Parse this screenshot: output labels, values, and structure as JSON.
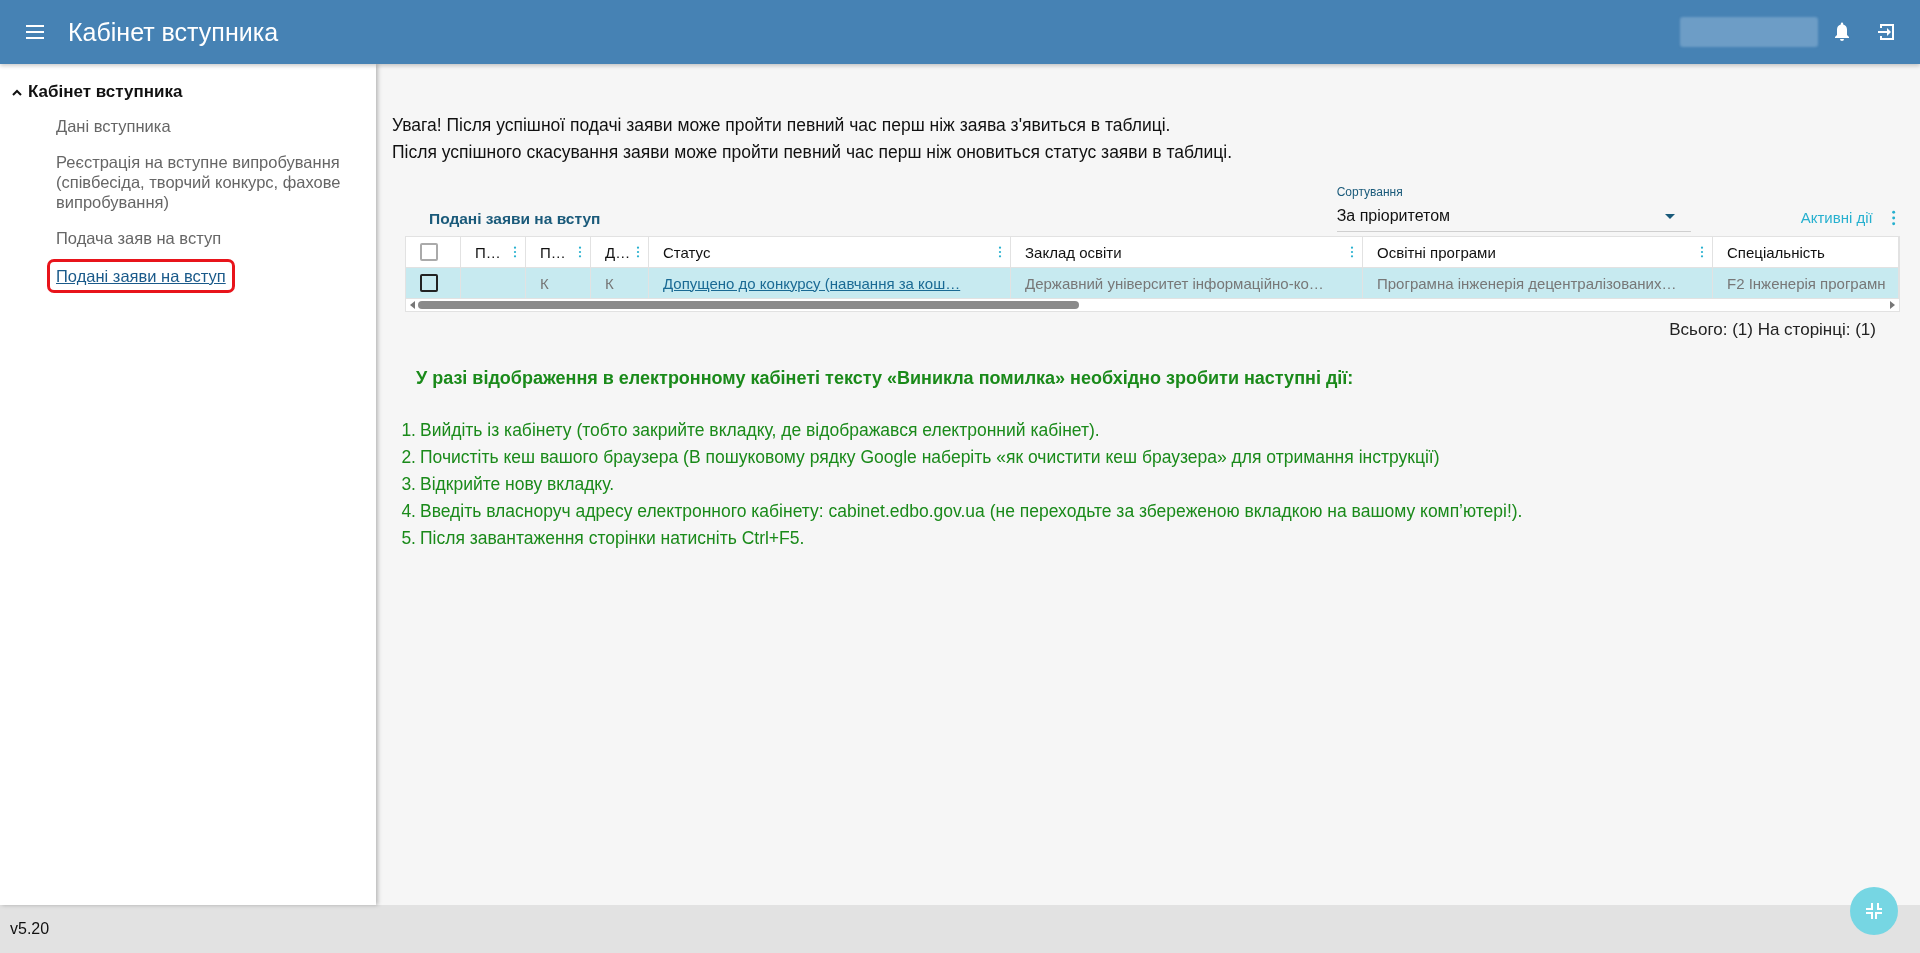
{
  "header": {
    "title": "Кабінет вступника"
  },
  "sidebar": {
    "section": {
      "label": "Кабінет вступника",
      "expanded": true
    },
    "items": [
      {
        "label": "Дані вступника",
        "selected": false
      },
      {
        "label": "Реєстрація на вступне випробування (співбесіда, творчий конкурс, фахове випробування)",
        "selected": false
      },
      {
        "label": "Подача заяв на вступ",
        "selected": false
      },
      {
        "label": "Подані заяви на вступ",
        "selected": true
      }
    ]
  },
  "notice": [
    "Увага! Після успішної подачі заяви може пройти певний час перш ніж заява з'явиться в таблиці.",
    "Після успішного скасування заяви може пройти певний час перш ніж оновиться статус заяви в таблиці."
  ],
  "table": {
    "title": "Подані заяви на вступ",
    "sort": {
      "label": "Сортування",
      "value": "За пріоритетом"
    },
    "actions_label": "Активні дії",
    "columns": [
      {
        "kind": "checkbox",
        "checked": false
      },
      {
        "kind": "text",
        "label": "П…",
        "menu": true
      },
      {
        "kind": "text",
        "label": "П…",
        "menu": true
      },
      {
        "kind": "text",
        "label": "Д…",
        "menu": true
      },
      {
        "kind": "text",
        "label": "Статус",
        "menu": true
      },
      {
        "kind": "text",
        "label": "Заклад освіти",
        "menu": true
      },
      {
        "kind": "text",
        "label": "Освітні програми",
        "menu": true
      },
      {
        "kind": "text",
        "label": "Спеціальність",
        "menu": false
      }
    ],
    "rows": [
      {
        "selected": true,
        "cells": [
          {
            "kind": "checkbox",
            "checked": false
          },
          {
            "kind": "empty"
          },
          {
            "kind": "text",
            "text": "К"
          },
          {
            "kind": "text",
            "text": "К"
          },
          {
            "kind": "link",
            "text": "Допущено до конкурсу (навчання за кош…"
          },
          {
            "kind": "text",
            "text": "Державний університет інформаційно-ко…"
          },
          {
            "kind": "text",
            "text": "Програмна інженерія децентралізованих…"
          },
          {
            "kind": "text",
            "text": "F2 Інженерія програмн"
          }
        ]
      }
    ],
    "totals": "Всього: (1) На сторінці: (1)"
  },
  "help": {
    "heading": "У разі відображення в електронному кабінеті тексту «Виникла помилка» необхідно зробити наступні дії:",
    "steps": [
      {
        "number": "1.",
        "text": "Вийдіть із кабінету (тобто закрийте вкладку, де відображався електронний кабінет)."
      },
      {
        "number": "2.",
        "text": "Почистіть кеш вашого браузера (В пошуковому рядку Google наберіть «як очистити кеш браузера» для отримання інструкції)"
      },
      {
        "number": "3.",
        "text": "Відкрийте нову вкладку."
      },
      {
        "number": "4.",
        "text": "Введіть власноруч адресу електронного кабінету: cabinet.edbo.gov.ua (не переходьте за збереженою вкладкою на вашому комп’ютері!)."
      },
      {
        "number": "5.",
        "text": "Після завантаження сторінки натисніть Ctrl+F5."
      }
    ]
  },
  "footer": {
    "version": "v5.20"
  }
}
